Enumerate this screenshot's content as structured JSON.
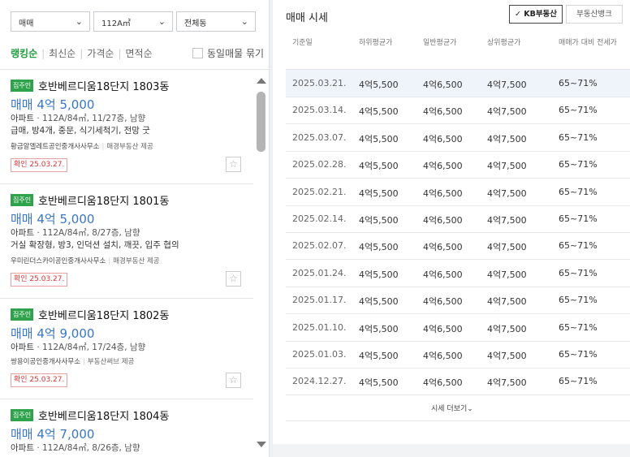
{
  "filters": {
    "trade": "매매",
    "area": "112A㎡",
    "building": "전체동"
  },
  "sorts": {
    "ranking": "랭킹순",
    "latest": "최신순",
    "price": "가격순",
    "area": "면적순",
    "same_listing": "동일매물 묶기"
  },
  "listings": [
    {
      "badge": "집주인",
      "title": "호반베르디움18단지 1803동",
      "price": "매매 4억 5,000",
      "type": "아파트",
      "spec": " · 112A/84㎡, 11/27층, 남향",
      "desc": "급매, 방4개, 중문, 식기세척기, 전망 굿",
      "agent": "황금알엘레트공인중개사사무소",
      "provider": "매경부동산 제공",
      "confirmed": "확인 25.03.27."
    },
    {
      "badge": "집주인",
      "title": "호반베르디움18단지 1801동",
      "price": "매매 4억 5,000",
      "type": "아파트",
      "spec": " · 112A/84㎡, 8/27층, 남향",
      "desc": "거실 확장형, 방3, 인덕션 설치, 깨끗, 입주 협의",
      "agent": "우미린더스카이공인중개사사무소",
      "provider": "매경부동산 제공",
      "confirmed": "확인 25.03.27."
    },
    {
      "badge": "집주인",
      "title": "호반베르디움18단지 1802동",
      "price": "매매 4억 9,000",
      "type": "아파트",
      "spec": " · 112A/84㎡, 17/24층, 남향",
      "desc": "",
      "agent": "쌍용이공인중개사사무소",
      "provider": "부동산써브 제공",
      "confirmed": "확인 25.03.27."
    },
    {
      "badge": "집주인",
      "title": "호반베르디움18단지 1804동",
      "price": "매매 4억 7,000",
      "type": "아파트",
      "spec": " · 112A/84㎡, 8/26층, 남향",
      "desc": "",
      "agent": "",
      "provider": "",
      "confirmed": ""
    }
  ],
  "market": {
    "title": "매매 시세",
    "tab_kb": "KB부동산",
    "tab_bank": "부동산뱅크",
    "headers": [
      "기준일",
      "하위평균가",
      "일반평균가",
      "상위평균가",
      "매매가 대비 전세가"
    ],
    "rows": [
      [
        "2025.03.21.",
        "4억5,500",
        "4억6,500",
        "4억7,500",
        "65~71%"
      ],
      [
        "2025.03.14.",
        "4억5,500",
        "4억6,500",
        "4억7,500",
        "65~71%"
      ],
      [
        "2025.03.07.",
        "4억5,500",
        "4억6,500",
        "4억7,500",
        "65~71%"
      ],
      [
        "2025.02.28.",
        "4억5,500",
        "4억6,500",
        "4억7,500",
        "65~71%"
      ],
      [
        "2025.02.21.",
        "4억5,500",
        "4억6,500",
        "4억7,500",
        "65~71%"
      ],
      [
        "2025.02.14.",
        "4억5,500",
        "4억6,500",
        "4억7,500",
        "65~71%"
      ],
      [
        "2025.02.07.",
        "4억5,500",
        "4억6,500",
        "4억7,500",
        "65~71%"
      ],
      [
        "2025.01.24.",
        "4억5,500",
        "4억6,500",
        "4억7,500",
        "65~71%"
      ],
      [
        "2025.01.17.",
        "4억5,500",
        "4억6,500",
        "4억7,500",
        "65~71%"
      ],
      [
        "2025.01.10.",
        "4억5,500",
        "4억6,500",
        "4억7,500",
        "65~71%"
      ],
      [
        "2025.01.03.",
        "4억5,500",
        "4억6,500",
        "4억7,500",
        "65~71%"
      ],
      [
        "2024.12.27.",
        "4억5,500",
        "4억6,500",
        "4억7,500",
        "65~71%"
      ]
    ],
    "more": "시세 더보기"
  }
}
